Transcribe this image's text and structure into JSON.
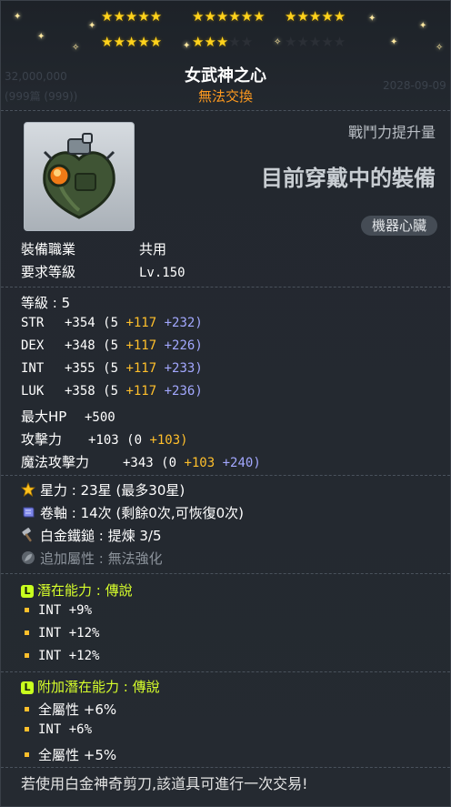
{
  "header": {
    "star_groups_row1": [
      "★★★★★",
      "★★★★★★",
      "★★★★★"
    ],
    "star_groups_row2_on": "★★★★★",
    "star_groups_row2_mid_on": "★★★",
    "star_groups_row2_mid_off": "★★",
    "star_groups_row2_off": "★★★★★",
    "ghost_left_1": "32,000,000",
    "ghost_left_2": "(999篇 (999))",
    "ghost_right": "2028-09-09"
  },
  "item": {
    "name": "女武神之心",
    "trade_status": "無法交換",
    "cp_label": "戰鬥力提升量",
    "equipped_text": "目前穿戴中的裝備",
    "type_tag": "機器心臟",
    "job_label": "裝備職業",
    "job_value": "共用",
    "level_req_label": "要求等級",
    "level_req_value": "Lv.150"
  },
  "stats": {
    "grade": "等級 : 5",
    "str": {
      "label": "STR",
      "total": "+354",
      "base": "(5",
      "flame": "+117",
      "star": "+232)"
    },
    "dex": {
      "label": "DEX",
      "total": "+348",
      "base": "(5",
      "flame": "+117",
      "star": "+226)"
    },
    "int": {
      "label": "INT",
      "total": "+355",
      "base": "(5",
      "flame": "+117",
      "star": "+233)"
    },
    "luk": {
      "label": "LUK",
      "total": "+358",
      "base": "(5",
      "flame": "+117",
      "star": "+236)"
    },
    "hp": {
      "label": "最大HP",
      "total": "+500"
    },
    "atk": {
      "label": "攻擊力",
      "total": "+103",
      "base": "(0",
      "flame": "+103)"
    },
    "matk": {
      "label": "魔法攻擊力",
      "total": "+343",
      "base": "(0",
      "flame": "+103",
      "star": "+240)"
    }
  },
  "enhance": {
    "starforce": "星力 : 23星 (最多30星)",
    "scroll": "卷軸 : 14次 (剩餘0次,可恢復0次)",
    "hammer": "白金鐵鎚 : 提煉 3/5",
    "added": "追加屬性 : 無法強化"
  },
  "potential": {
    "badge": "L",
    "title": "潛在能力 : 傳說",
    "lines": [
      "INT +9%",
      "INT +12%",
      "INT +12%"
    ]
  },
  "bonus_potential": {
    "badge": "L",
    "title": "附加潛在能力 : 傳說",
    "lines": [
      "全屬性 +6%",
      "INT +6%",
      "全屬性 +5%"
    ]
  },
  "footer": "若使用白金神奇剪刀,該道具可進行一次交易!"
}
